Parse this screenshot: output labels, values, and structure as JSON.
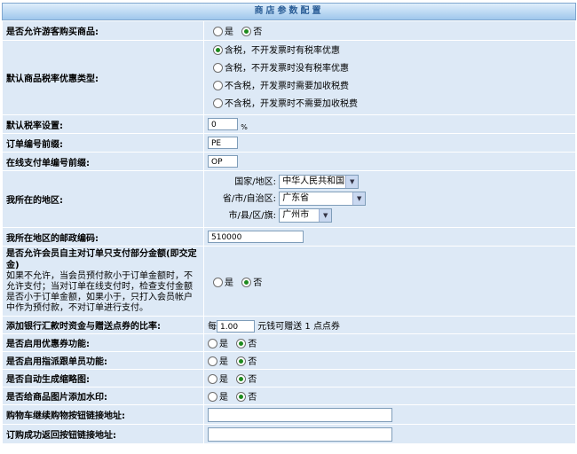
{
  "title": "商店参数配置",
  "rows": {
    "guest_buy": {
      "label": "是否允许游客购买商品:",
      "yes": "是",
      "no": "否"
    },
    "tax_type": {
      "label": "默认商品税率优惠类型:",
      "options": [
        "含税，不开发票时有税率优惠",
        "含税，不开发票时没有税率优惠",
        "不含税，开发票时需要加收税费",
        "不含税，开发票时不需要加收税费"
      ]
    },
    "tax_rate": {
      "label": "默认税率设置:",
      "value": "0",
      "unit": "%"
    },
    "order_prefix": {
      "label": "订单编号前缀:",
      "value": "PE"
    },
    "pay_prefix": {
      "label": "在线支付单编号前缀:",
      "value": "OP"
    },
    "region": {
      "label": "我所在的地区:",
      "country_label": "国家/地区:",
      "country_value": "中华人民共和国",
      "province_label": "省/市/自治区:",
      "province_value": "广东省",
      "city_label": "市/县/区/旗:",
      "city_value": "广州市"
    },
    "postcode": {
      "label": "我所在地区的邮政编码:",
      "value": "510000"
    },
    "partial_pay": {
      "label": "是否允许会员自主对订单只支付部分金额(即交定金)",
      "help": "如果不允许，当会员预付款小于订单金额时，不允许支付；当对订单在线支付时，检查支付金额是否小于订单金额，如果小于，只打入会员帐户中作为预付款，不对订单进行支付。",
      "yes": "是",
      "no": "否"
    },
    "coupon_ratio": {
      "label": "添加银行汇款时资金与赠送点券的比率:",
      "prefix": "每",
      "value": "1.00",
      "middle": "元钱可赠送",
      "points": "1",
      "suffix": "点点券"
    },
    "coupon_enable": {
      "label": "是否启用优惠券功能:",
      "yes": "是",
      "no": "否"
    },
    "guide_enable": {
      "label": "是否启用指派跟单员功能:",
      "yes": "是",
      "no": "否"
    },
    "thumbnail": {
      "label": "是否自动生成缩略图:",
      "yes": "是",
      "no": "否"
    },
    "watermark": {
      "label": "是否给商品图片添加水印:",
      "yes": "是",
      "no": "否"
    },
    "cart_link": {
      "label": "购物车继续购物按钮链接地址:",
      "value": ""
    },
    "success_link": {
      "label": "订购成功返回按钮链接地址:",
      "value": ""
    }
  },
  "colors": {
    "row_bg": "#dde9f6",
    "header_text": "#2a5d96",
    "radio_on": "#1d8a1d"
  }
}
